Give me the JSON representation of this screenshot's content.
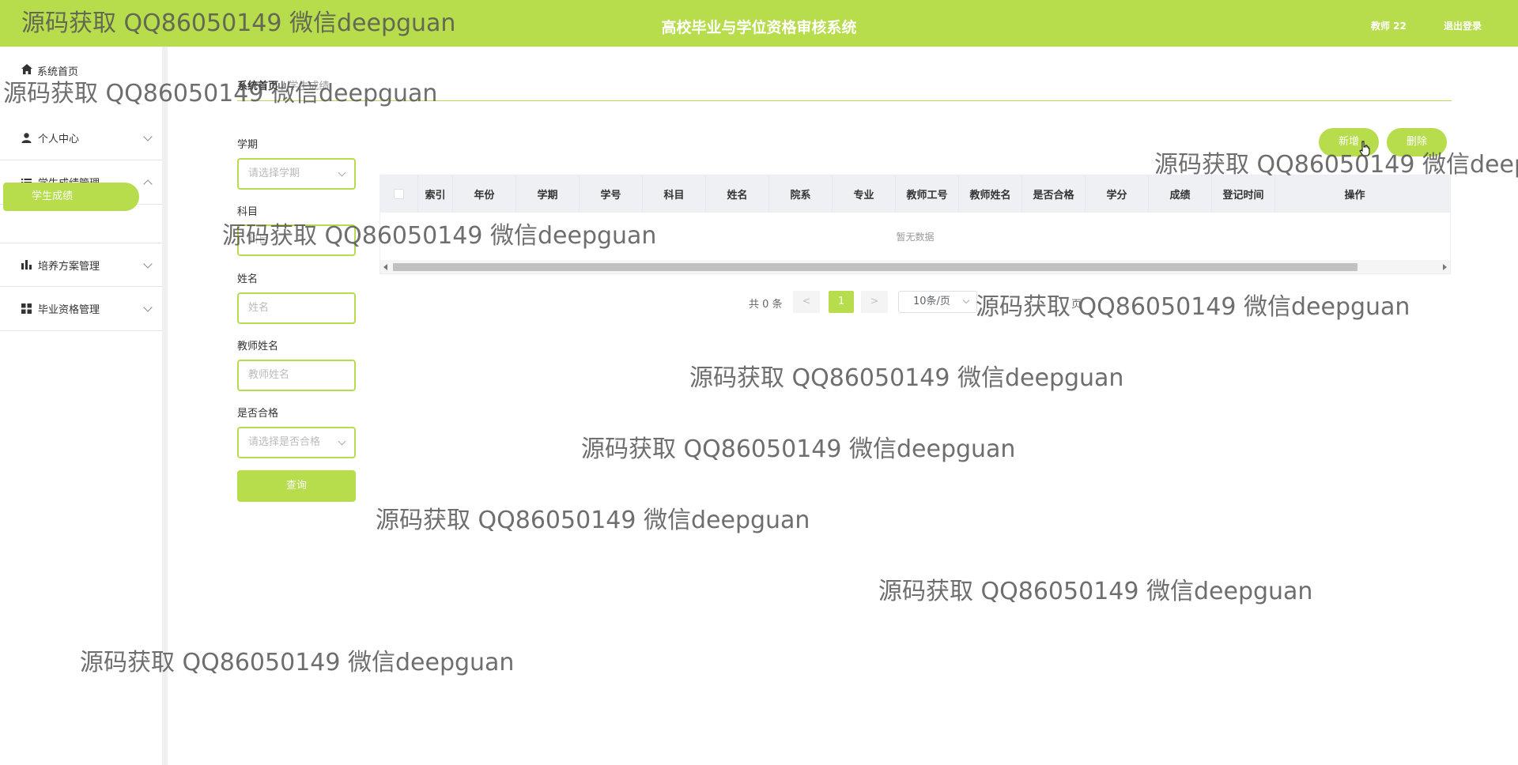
{
  "header": {
    "title": "高校毕业与学位资格审核系统",
    "user": "教师 22",
    "logout": "退出登录"
  },
  "sidebar": {
    "home": "系统首页",
    "groups": [
      {
        "label": "个人中心",
        "icon": "user-icon",
        "expanded": false
      },
      {
        "label": "学生成绩管理",
        "icon": "list-icon",
        "expanded": true
      },
      {
        "label": "培养方案管理",
        "icon": "bar-chart-icon",
        "expanded": false
      },
      {
        "label": "毕业资格管理",
        "icon": "grid-icon",
        "expanded": false
      }
    ],
    "active_sub": "学生成绩"
  },
  "breadcrumb": {
    "home": "系统首页",
    "separator": "/",
    "current": "学生成绩"
  },
  "filters": {
    "semester": {
      "label": "学期",
      "placeholder": "请选择学期"
    },
    "subject": {
      "label": "科目",
      "placeholder": "科目"
    },
    "name": {
      "label": "姓名",
      "placeholder": "姓名"
    },
    "teacher": {
      "label": "教师姓名",
      "placeholder": "教师姓名"
    },
    "passed": {
      "label": "是否合格",
      "placeholder": "请选择是否合格"
    },
    "query": "查询"
  },
  "actions": {
    "add": "新增",
    "delete": "删除"
  },
  "table": {
    "columns": [
      "索引",
      "年份",
      "学期",
      "学号",
      "科目",
      "姓名",
      "院系",
      "专业",
      "教师工号",
      "教师姓名",
      "是否合格",
      "学分",
      "成绩",
      "登记时间",
      "操作"
    ],
    "empty_text": "暂无数据"
  },
  "pagination": {
    "total": "共 0 条",
    "prev": "<",
    "page": "1",
    "next": ">",
    "page_size": "10条/页",
    "goto_suffix": "页"
  },
  "watermark": "源码获取 QQ86050149 微信deepguan",
  "colors": {
    "accent": "#b7dc4c"
  }
}
